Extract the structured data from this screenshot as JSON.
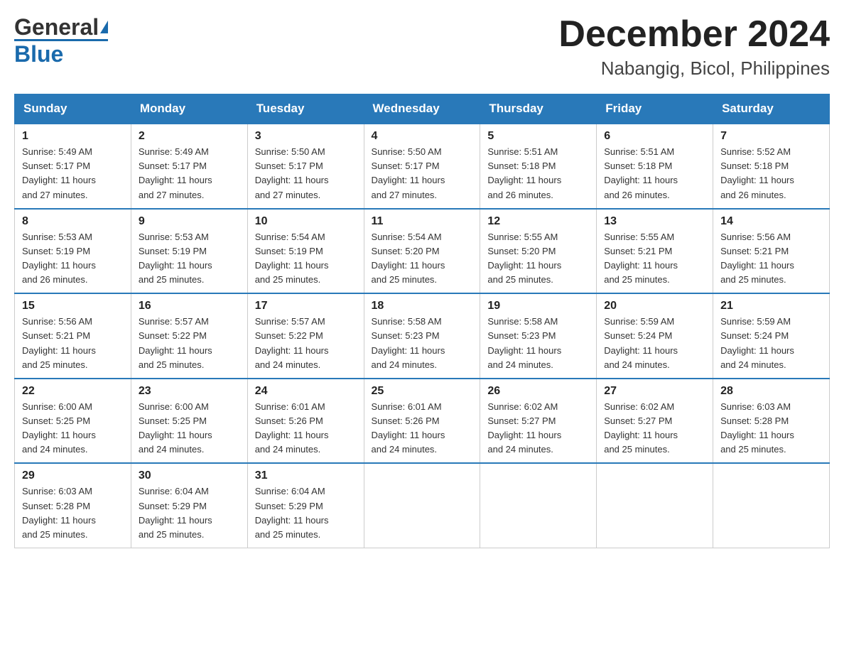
{
  "logo": {
    "general": "General",
    "blue": "Blue"
  },
  "title": "December 2024",
  "subtitle": "Nabangig, Bicol, Philippines",
  "days": [
    "Sunday",
    "Monday",
    "Tuesday",
    "Wednesday",
    "Thursday",
    "Friday",
    "Saturday"
  ],
  "weeks": [
    [
      {
        "num": "1",
        "sunrise": "5:49 AM",
        "sunset": "5:17 PM",
        "daylight": "11 hours and 27 minutes."
      },
      {
        "num": "2",
        "sunrise": "5:49 AM",
        "sunset": "5:17 PM",
        "daylight": "11 hours and 27 minutes."
      },
      {
        "num": "3",
        "sunrise": "5:50 AM",
        "sunset": "5:17 PM",
        "daylight": "11 hours and 27 minutes."
      },
      {
        "num": "4",
        "sunrise": "5:50 AM",
        "sunset": "5:17 PM",
        "daylight": "11 hours and 27 minutes."
      },
      {
        "num": "5",
        "sunrise": "5:51 AM",
        "sunset": "5:18 PM",
        "daylight": "11 hours and 26 minutes."
      },
      {
        "num": "6",
        "sunrise": "5:51 AM",
        "sunset": "5:18 PM",
        "daylight": "11 hours and 26 minutes."
      },
      {
        "num": "7",
        "sunrise": "5:52 AM",
        "sunset": "5:18 PM",
        "daylight": "11 hours and 26 minutes."
      }
    ],
    [
      {
        "num": "8",
        "sunrise": "5:53 AM",
        "sunset": "5:19 PM",
        "daylight": "11 hours and 26 minutes."
      },
      {
        "num": "9",
        "sunrise": "5:53 AM",
        "sunset": "5:19 PM",
        "daylight": "11 hours and 25 minutes."
      },
      {
        "num": "10",
        "sunrise": "5:54 AM",
        "sunset": "5:19 PM",
        "daylight": "11 hours and 25 minutes."
      },
      {
        "num": "11",
        "sunrise": "5:54 AM",
        "sunset": "5:20 PM",
        "daylight": "11 hours and 25 minutes."
      },
      {
        "num": "12",
        "sunrise": "5:55 AM",
        "sunset": "5:20 PM",
        "daylight": "11 hours and 25 minutes."
      },
      {
        "num": "13",
        "sunrise": "5:55 AM",
        "sunset": "5:21 PM",
        "daylight": "11 hours and 25 minutes."
      },
      {
        "num": "14",
        "sunrise": "5:56 AM",
        "sunset": "5:21 PM",
        "daylight": "11 hours and 25 minutes."
      }
    ],
    [
      {
        "num": "15",
        "sunrise": "5:56 AM",
        "sunset": "5:21 PM",
        "daylight": "11 hours and 25 minutes."
      },
      {
        "num": "16",
        "sunrise": "5:57 AM",
        "sunset": "5:22 PM",
        "daylight": "11 hours and 25 minutes."
      },
      {
        "num": "17",
        "sunrise": "5:57 AM",
        "sunset": "5:22 PM",
        "daylight": "11 hours and 24 minutes."
      },
      {
        "num": "18",
        "sunrise": "5:58 AM",
        "sunset": "5:23 PM",
        "daylight": "11 hours and 24 minutes."
      },
      {
        "num": "19",
        "sunrise": "5:58 AM",
        "sunset": "5:23 PM",
        "daylight": "11 hours and 24 minutes."
      },
      {
        "num": "20",
        "sunrise": "5:59 AM",
        "sunset": "5:24 PM",
        "daylight": "11 hours and 24 minutes."
      },
      {
        "num": "21",
        "sunrise": "5:59 AM",
        "sunset": "5:24 PM",
        "daylight": "11 hours and 24 minutes."
      }
    ],
    [
      {
        "num": "22",
        "sunrise": "6:00 AM",
        "sunset": "5:25 PM",
        "daylight": "11 hours and 24 minutes."
      },
      {
        "num": "23",
        "sunrise": "6:00 AM",
        "sunset": "5:25 PM",
        "daylight": "11 hours and 24 minutes."
      },
      {
        "num": "24",
        "sunrise": "6:01 AM",
        "sunset": "5:26 PM",
        "daylight": "11 hours and 24 minutes."
      },
      {
        "num": "25",
        "sunrise": "6:01 AM",
        "sunset": "5:26 PM",
        "daylight": "11 hours and 24 minutes."
      },
      {
        "num": "26",
        "sunrise": "6:02 AM",
        "sunset": "5:27 PM",
        "daylight": "11 hours and 24 minutes."
      },
      {
        "num": "27",
        "sunrise": "6:02 AM",
        "sunset": "5:27 PM",
        "daylight": "11 hours and 25 minutes."
      },
      {
        "num": "28",
        "sunrise": "6:03 AM",
        "sunset": "5:28 PM",
        "daylight": "11 hours and 25 minutes."
      }
    ],
    [
      {
        "num": "29",
        "sunrise": "6:03 AM",
        "sunset": "5:28 PM",
        "daylight": "11 hours and 25 minutes."
      },
      {
        "num": "30",
        "sunrise": "6:04 AM",
        "sunset": "5:29 PM",
        "daylight": "11 hours and 25 minutes."
      },
      {
        "num": "31",
        "sunrise": "6:04 AM",
        "sunset": "5:29 PM",
        "daylight": "11 hours and 25 minutes."
      },
      null,
      null,
      null,
      null
    ]
  ]
}
